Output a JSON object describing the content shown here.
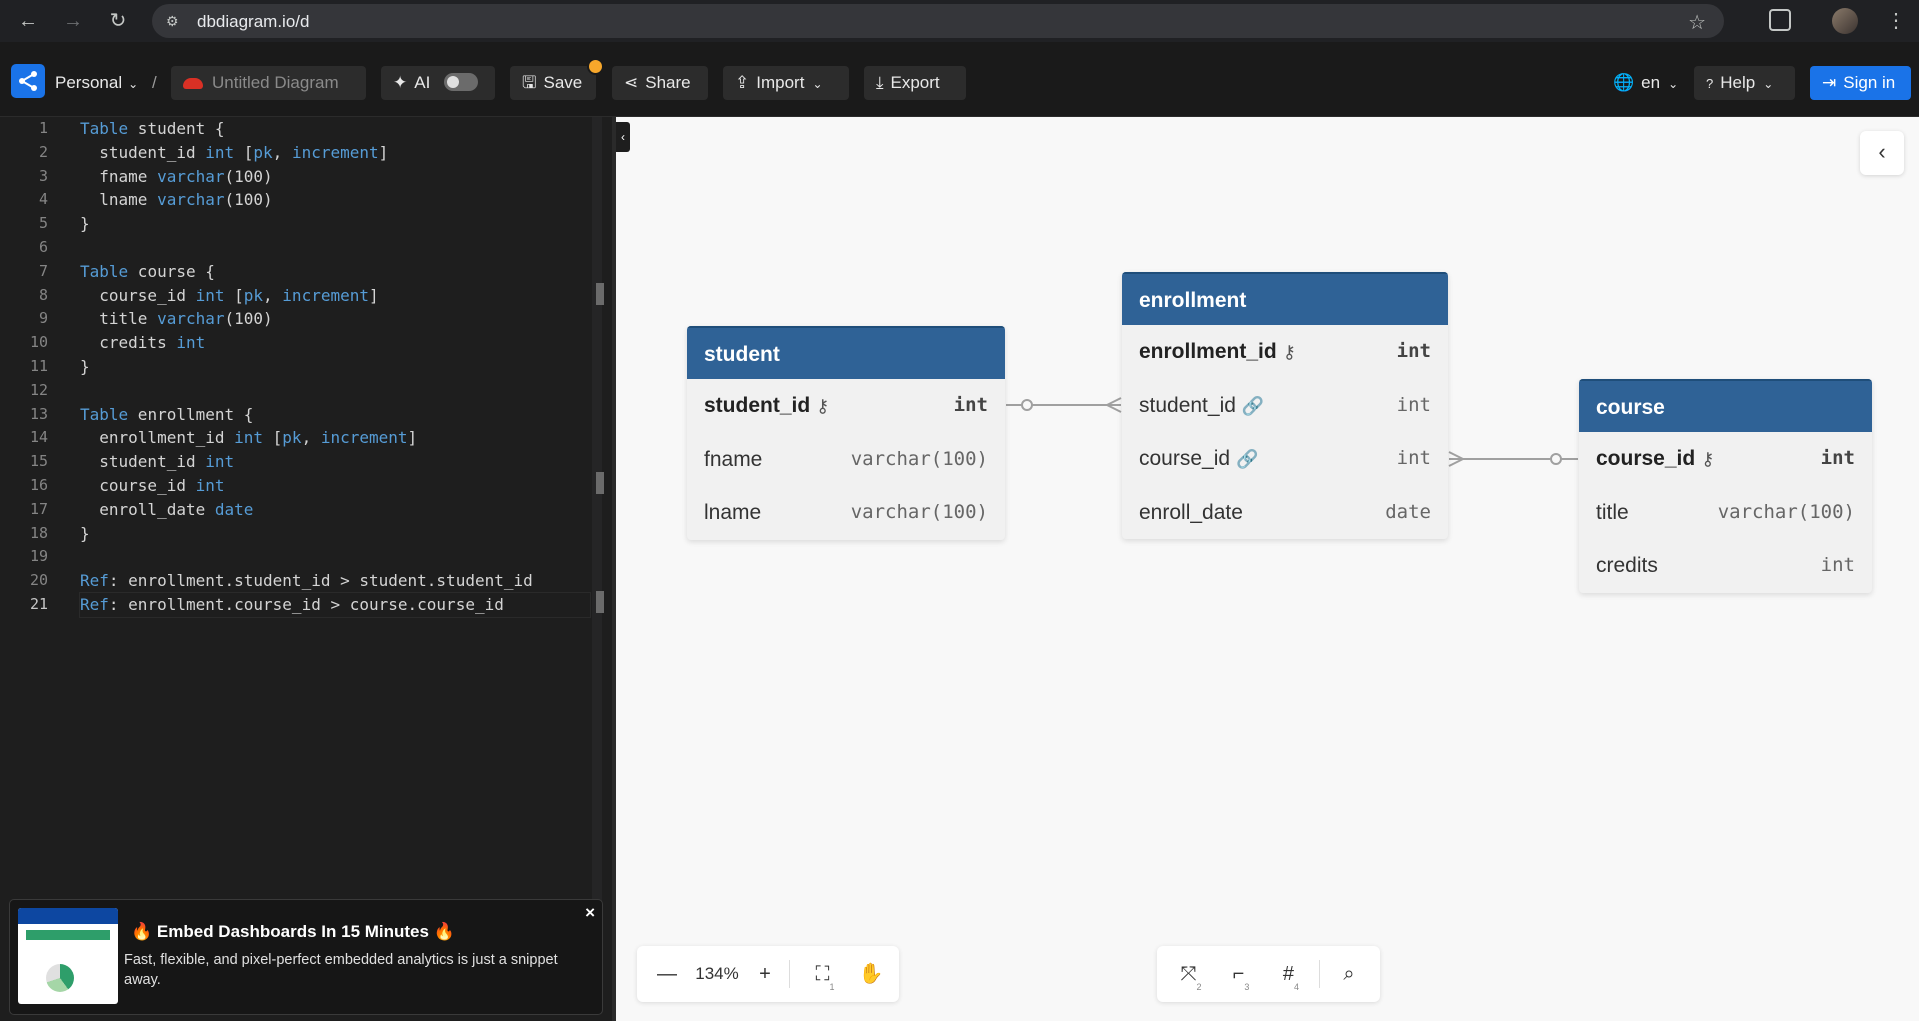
{
  "browser": {
    "url": "dbdiagram.io/d"
  },
  "header": {
    "workspace": "Personal",
    "separator": "/",
    "diagram_name": "Untitled Diagram",
    "ai_label": "AI",
    "save_label": "Save",
    "share_label": "Share",
    "import_label": "Import",
    "export_label": "Export",
    "language": "en",
    "help_label": "Help",
    "signin_label": "Sign in"
  },
  "editor": {
    "lines": [
      {
        "n": "1",
        "parts": [
          [
            "kw",
            "Table"
          ],
          [
            "t",
            " student {"
          ]
        ]
      },
      {
        "n": "2",
        "parts": [
          [
            "t",
            "  student_id "
          ],
          [
            "ty",
            "int"
          ],
          [
            "t",
            " ["
          ],
          [
            "ty",
            "pk"
          ],
          [
            "t",
            ", "
          ],
          [
            "ty",
            "increment"
          ],
          [
            "t",
            "]"
          ]
        ]
      },
      {
        "n": "3",
        "parts": [
          [
            "t",
            "  fname "
          ],
          [
            "ty",
            "varchar"
          ],
          [
            "t",
            "(100)"
          ]
        ]
      },
      {
        "n": "4",
        "parts": [
          [
            "t",
            "  lname "
          ],
          [
            "ty",
            "varchar"
          ],
          [
            "t",
            "(100)"
          ]
        ]
      },
      {
        "n": "5",
        "parts": [
          [
            "t",
            "}"
          ]
        ]
      },
      {
        "n": "6",
        "parts": [
          [
            "t",
            ""
          ]
        ]
      },
      {
        "n": "7",
        "parts": [
          [
            "kw",
            "Table"
          ],
          [
            "t",
            " course {"
          ]
        ]
      },
      {
        "n": "8",
        "parts": [
          [
            "t",
            "  course_id "
          ],
          [
            "ty",
            "int"
          ],
          [
            "t",
            " ["
          ],
          [
            "ty",
            "pk"
          ],
          [
            "t",
            ", "
          ],
          [
            "ty",
            "increment"
          ],
          [
            "t",
            "]"
          ]
        ]
      },
      {
        "n": "9",
        "parts": [
          [
            "t",
            "  title "
          ],
          [
            "ty",
            "varchar"
          ],
          [
            "t",
            "(100)"
          ]
        ]
      },
      {
        "n": "10",
        "parts": [
          [
            "t",
            "  credits "
          ],
          [
            "ty",
            "int"
          ]
        ]
      },
      {
        "n": "11",
        "parts": [
          [
            "t",
            "}"
          ]
        ]
      },
      {
        "n": "12",
        "parts": [
          [
            "t",
            ""
          ]
        ]
      },
      {
        "n": "13",
        "parts": [
          [
            "kw",
            "Table"
          ],
          [
            "t",
            " enrollment {"
          ]
        ]
      },
      {
        "n": "14",
        "parts": [
          [
            "t",
            "  enrollment_id "
          ],
          [
            "ty",
            "int"
          ],
          [
            "t",
            " ["
          ],
          [
            "ty",
            "pk"
          ],
          [
            "t",
            ", "
          ],
          [
            "ty",
            "increment"
          ],
          [
            "t",
            "]"
          ]
        ]
      },
      {
        "n": "15",
        "parts": [
          [
            "t",
            "  student_id "
          ],
          [
            "ty",
            "int"
          ]
        ]
      },
      {
        "n": "16",
        "parts": [
          [
            "t",
            "  course_id "
          ],
          [
            "ty",
            "int"
          ]
        ]
      },
      {
        "n": "17",
        "parts": [
          [
            "t",
            "  enroll_date "
          ],
          [
            "ty",
            "date"
          ]
        ]
      },
      {
        "n": "18",
        "parts": [
          [
            "t",
            "}"
          ]
        ]
      },
      {
        "n": "19",
        "parts": [
          [
            "t",
            ""
          ]
        ]
      },
      {
        "n": "20",
        "parts": [
          [
            "kw",
            "Ref"
          ],
          [
            "t",
            ": enrollment.student_id > student.student_id"
          ]
        ]
      },
      {
        "n": "21",
        "parts": [
          [
            "kw",
            "Ref"
          ],
          [
            "t",
            ": enrollment.course_id > course.course_id"
          ]
        ]
      }
    ],
    "active_line": "21"
  },
  "ad": {
    "title": "Embed Dashboards In 15 Minutes",
    "body": "Fast, flexible, and pixel-perfect embedded analytics is just a snippet away.",
    "close": "×"
  },
  "tables": {
    "student": {
      "name": "student",
      "fields": [
        {
          "name": "student_id",
          "type": "int",
          "pk": true
        },
        {
          "name": "fname",
          "type": "varchar(100)",
          "pk": false
        },
        {
          "name": "lname",
          "type": "varchar(100)",
          "pk": false
        }
      ]
    },
    "enrollment": {
      "name": "enrollment",
      "fields": [
        {
          "name": "enrollment_id",
          "type": "int",
          "pk": true
        },
        {
          "name": "student_id",
          "type": "int",
          "pk": false,
          "fk": true
        },
        {
          "name": "course_id",
          "type": "int",
          "pk": false,
          "fk": true
        },
        {
          "name": "enroll_date",
          "type": "date",
          "pk": false
        }
      ]
    },
    "course": {
      "name": "course",
      "fields": [
        {
          "name": "course_id",
          "type": "int",
          "pk": true
        },
        {
          "name": "title",
          "type": "varchar(100)",
          "pk": false
        },
        {
          "name": "credits",
          "type": "int",
          "pk": false
        }
      ]
    }
  },
  "relationships": [
    {
      "from": "enrollment.student_id",
      "to": "student.student_id",
      "type": "many-to-one"
    },
    {
      "from": "enrollment.course_id",
      "to": "course.course_id",
      "type": "many-to-one"
    }
  ],
  "zoom": {
    "level": "134%",
    "minus": "—",
    "plus": "+"
  },
  "tools": {
    "sub_2": "2",
    "sub_3": "3",
    "sub_4": "4",
    "sub_1": "1"
  },
  "colors": {
    "table_header": "#2f6296",
    "accent": "#1a73e8",
    "save_badge": "#f7a72b"
  }
}
